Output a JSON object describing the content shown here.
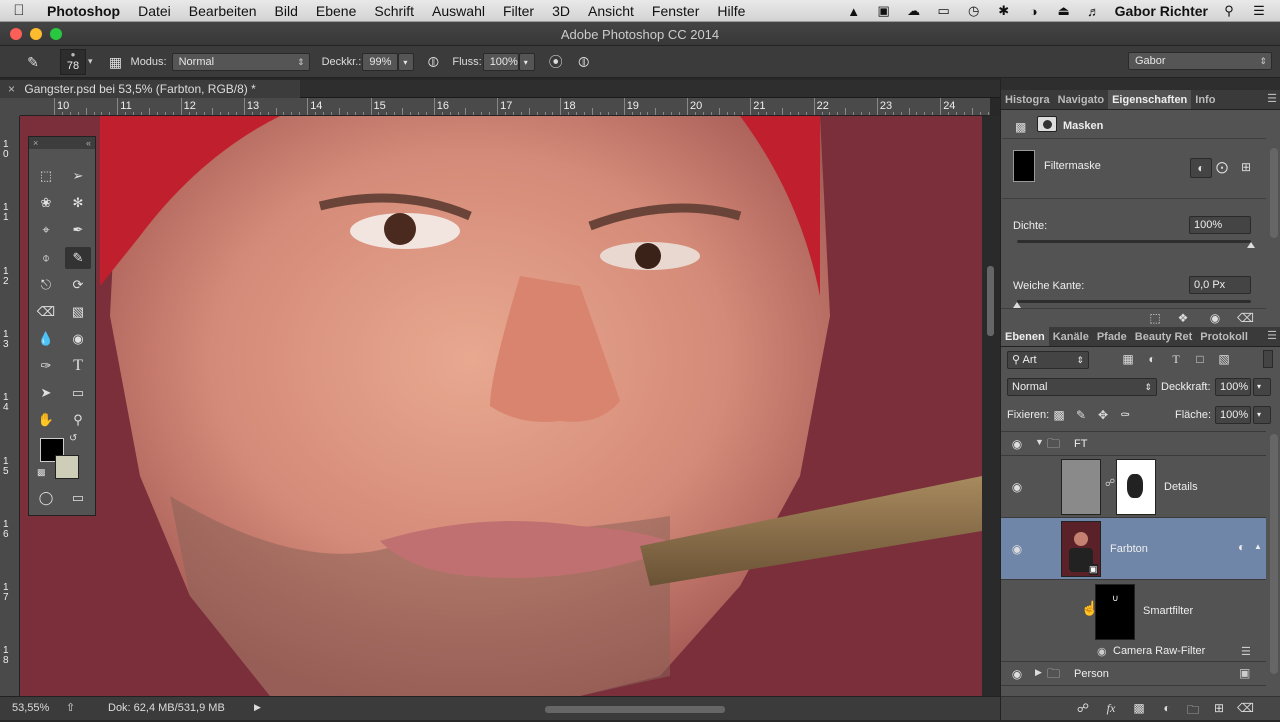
{
  "menubar": {
    "apple": "",
    "app": "Photoshop",
    "items": [
      "Datei",
      "Bearbeiten",
      "Bild",
      "Ebene",
      "Schrift",
      "Auswahl",
      "Filter",
      "3D",
      "Ansicht",
      "Fenster",
      "Hilfe"
    ],
    "user": "Gabor Richter"
  },
  "window": {
    "title": "Adobe Photoshop CC 2014"
  },
  "options": {
    "brush_size": "78",
    "modus_label": "Modus:",
    "modus_value": "Normal",
    "deckkraft_label": "Deckkr.:",
    "deckkraft_value": "99%",
    "fluss_label": "Fluss:",
    "fluss_value": "100%",
    "workspace": "Gabor"
  },
  "document": {
    "tab_title": "Gangster.psd bei 53,5% (Farbton, RGB/8) *",
    "close": "×"
  },
  "ruler": {
    "h": [
      "10",
      "11",
      "12",
      "13",
      "14",
      "15",
      "16",
      "17",
      "18",
      "19",
      "20",
      "21",
      "22",
      "23",
      "24"
    ],
    "v": [
      "10",
      "11",
      "12",
      "13",
      "14",
      "15",
      "16",
      "17",
      "18"
    ]
  },
  "status": {
    "zoom": "53,55%",
    "doc": "Dok: 62,4 MB/531,9 MB"
  },
  "props_panel": {
    "tabs": [
      "Histogra",
      "Navigato",
      "Eigenschaften",
      "Info"
    ],
    "active_tab": 2,
    "section": "Masken",
    "mask_name": "Filtermaske",
    "dichte_label": "Dichte:",
    "dichte_value": "100%",
    "dichte_fraction": 1.0,
    "weiche_label": "Weiche Kante:",
    "weiche_value": "0,0 Px",
    "weiche_fraction": 0.0
  },
  "layers_panel": {
    "tabs": [
      "Ebenen",
      "Kanäle",
      "Pfade",
      "Beauty Ret",
      "Protokoll"
    ],
    "active_tab": 0,
    "filter_kind": "Art",
    "blend_mode": "Normal",
    "deckkraft_label": "Deckkraft:",
    "deckkraft_value": "100%",
    "fixieren_label": "Fixieren:",
    "flaeche_label": "Fläche:",
    "flaeche_value": "100%",
    "layers": [
      {
        "name": "FT",
        "type": "group"
      },
      {
        "name": "Details"
      },
      {
        "name": "Farbton"
      },
      {
        "name": "Smartfilter"
      },
      {
        "name": "Camera Raw-Filter"
      },
      {
        "name": "Person",
        "type": "group"
      }
    ]
  },
  "colors": {
    "accent_selected_layer": "#6f86a8",
    "canvas_bg": "#7a2f3a",
    "bandana": "#c0202e"
  }
}
